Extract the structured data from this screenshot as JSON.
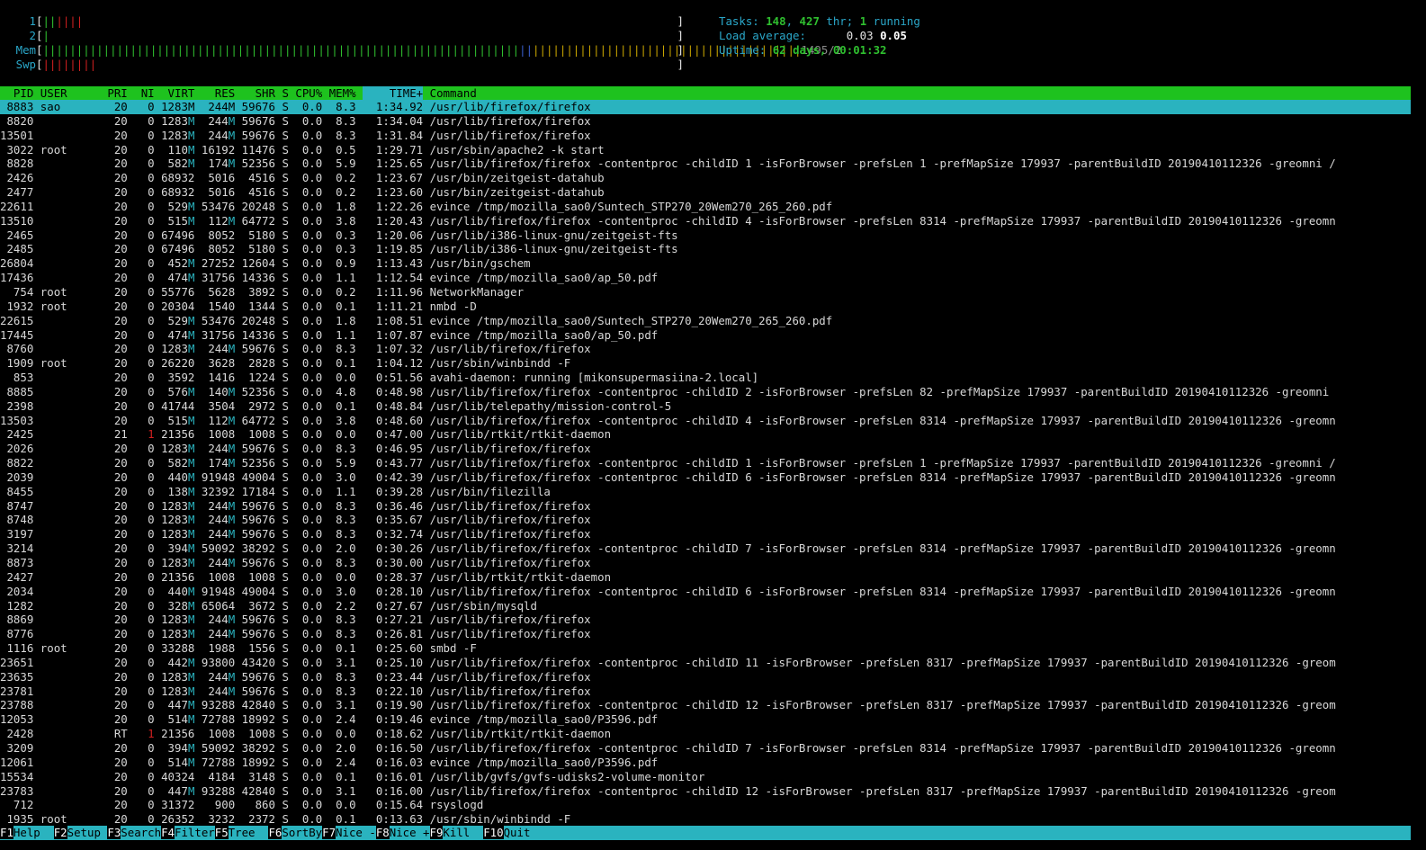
{
  "meters": [
    {
      "label": "1",
      "segments": [
        {
          "c": "g",
          "t": "||"
        },
        {
          "c": "r",
          "t": "||||"
        }
      ],
      "value": ""
    },
    {
      "label": "2",
      "segments": [
        {
          "c": "g",
          "t": "|"
        }
      ],
      "value": ""
    },
    {
      "label": "Mem",
      "segments": [
        {
          "c": "g",
          "t": "|||||||||||||||||||||||||||||||||||||||||||||||||||||||||||||||||||||||"
        },
        {
          "c": "b",
          "t": "||"
        },
        {
          "c": "y",
          "t": "||||||||||||||||||||||||||||||||||||||||"
        }
      ],
      "value": "1495/2"
    },
    {
      "label": "Swp",
      "segments": [
        {
          "c": "r",
          "t": "||||||||"
        }
      ],
      "value": ""
    }
  ],
  "stats": {
    "tasks_label": "Tasks: ",
    "tasks": "148",
    "thr_sep": ", ",
    "thr": "427",
    "thr_label": " thr; ",
    "running": "1",
    "running_label": " running",
    "load_label": "Load average: ",
    "load1": "0.03",
    "load2": "0.05",
    "uptime_label": "Uptime: ",
    "uptime": "62 days, 00:01:32"
  },
  "header": {
    "pid": "PID",
    "user": "USER",
    "pri": "PRI",
    "ni": "NI",
    "virt": "VIRT",
    "res": "RES",
    "shr": "SHR",
    "s": "S",
    "cpu": "CPU%",
    "mem": "MEM%",
    "time": "TIME+",
    "command": "Command"
  },
  "processes": [
    [
      "8883",
      "sao",
      "20",
      "0",
      "1283M",
      "244M",
      "59676",
      "S",
      "0.0",
      "8.3",
      "1:34.92",
      "/usr/lib/firefox/firefox"
    ],
    [
      "8820",
      "",
      "20",
      "0",
      "1283M",
      "244M",
      "59676",
      "S",
      "0.0",
      "8.3",
      "1:34.04",
      "/usr/lib/firefox/firefox"
    ],
    [
      "13501",
      "",
      "20",
      "0",
      "1283M",
      "244M",
      "59676",
      "S",
      "0.0",
      "8.3",
      "1:31.84",
      "/usr/lib/firefox/firefox"
    ],
    [
      "3022",
      "root",
      "20",
      "0",
      "110M",
      "16192",
      "11476",
      "S",
      "0.0",
      "0.5",
      "1:29.71",
      "/usr/sbin/apache2 -k start"
    ],
    [
      "8828",
      "",
      "20",
      "0",
      "582M",
      "174M",
      "52356",
      "S",
      "0.0",
      "5.9",
      "1:25.65",
      "/usr/lib/firefox/firefox -contentproc -childID 1 -isForBrowser -prefsLen 1 -prefMapSize 179937 -parentBuildID 20190410112326 -greomni /"
    ],
    [
      "2426",
      "",
      "20",
      "0",
      "68932",
      "5016",
      "4516",
      "S",
      "0.0",
      "0.2",
      "1:23.67",
      "/usr/bin/zeitgeist-datahub"
    ],
    [
      "2477",
      "",
      "20",
      "0",
      "68932",
      "5016",
      "4516",
      "S",
      "0.0",
      "0.2",
      "1:23.60",
      "/usr/bin/zeitgeist-datahub"
    ],
    [
      "22611",
      "",
      "20",
      "0",
      "529M",
      "53476",
      "20248",
      "S",
      "0.0",
      "1.8",
      "1:22.26",
      "evince /tmp/mozilla_sao0/Suntech_STP270_20Wem270_265_260.pdf"
    ],
    [
      "13510",
      "",
      "20",
      "0",
      "515M",
      "112M",
      "64772",
      "S",
      "0.0",
      "3.8",
      "1:20.43",
      "/usr/lib/firefox/firefox -contentproc -childID 4 -isForBrowser -prefsLen 8314 -prefMapSize 179937 -parentBuildID 20190410112326 -greomn"
    ],
    [
      "2465",
      "",
      "20",
      "0",
      "67496",
      "8052",
      "5180",
      "S",
      "0.0",
      "0.3",
      "1:20.06",
      "/usr/lib/i386-linux-gnu/zeitgeist-fts"
    ],
    [
      "2485",
      "",
      "20",
      "0",
      "67496",
      "8052",
      "5180",
      "S",
      "0.0",
      "0.3",
      "1:19.85",
      "/usr/lib/i386-linux-gnu/zeitgeist-fts"
    ],
    [
      "26804",
      "",
      "20",
      "0",
      "452M",
      "27252",
      "12604",
      "S",
      "0.0",
      "0.9",
      "1:13.43",
      "/usr/bin/gschem"
    ],
    [
      "17436",
      "",
      "20",
      "0",
      "474M",
      "31756",
      "14336",
      "S",
      "0.0",
      "1.1",
      "1:12.54",
      "evince /tmp/mozilla_sao0/ap_50.pdf"
    ],
    [
      "754",
      "root",
      "20",
      "0",
      "55776",
      "5628",
      "3892",
      "S",
      "0.0",
      "0.2",
      "1:11.96",
      "NetworkManager"
    ],
    [
      "1932",
      "root",
      "20",
      "0",
      "20304",
      "1540",
      "1344",
      "S",
      "0.0",
      "0.1",
      "1:11.21",
      "nmbd -D"
    ],
    [
      "22615",
      "",
      "20",
      "0",
      "529M",
      "53476",
      "20248",
      "S",
      "0.0",
      "1.8",
      "1:08.51",
      "evince /tmp/mozilla_sao0/Suntech_STP270_20Wem270_265_260.pdf"
    ],
    [
      "17445",
      "",
      "20",
      "0",
      "474M",
      "31756",
      "14336",
      "S",
      "0.0",
      "1.1",
      "1:07.87",
      "evince /tmp/mozilla_sao0/ap_50.pdf"
    ],
    [
      "8760",
      "",
      "20",
      "0",
      "1283M",
      "244M",
      "59676",
      "S",
      "0.0",
      "8.3",
      "1:07.32",
      "/usr/lib/firefox/firefox"
    ],
    [
      "1909",
      "root",
      "20",
      "0",
      "26220",
      "3628",
      "2828",
      "S",
      "0.0",
      "0.1",
      "1:04.12",
      "/usr/sbin/winbindd -F"
    ],
    [
      "853",
      "",
      "20",
      "0",
      "3592",
      "1416",
      "1224",
      "S",
      "0.0",
      "0.0",
      "0:51.56",
      "avahi-daemon: running [mikonsupermasiina-2.local]"
    ],
    [
      "8885",
      "",
      "20",
      "0",
      "576M",
      "140M",
      "52356",
      "S",
      "0.0",
      "4.8",
      "0:48.98",
      "/usr/lib/firefox/firefox -contentproc -childID 2 -isForBrowser -prefsLen 82 -prefMapSize 179937 -parentBuildID 20190410112326 -greomni"
    ],
    [
      "2398",
      "",
      "20",
      "0",
      "41744",
      "3504",
      "2972",
      "S",
      "0.0",
      "0.1",
      "0:48.84",
      "/usr/lib/telepathy/mission-control-5"
    ],
    [
      "13503",
      "",
      "20",
      "0",
      "515M",
      "112M",
      "64772",
      "S",
      "0.0",
      "3.8",
      "0:48.60",
      "/usr/lib/firefox/firefox -contentproc -childID 4 -isForBrowser -prefsLen 8314 -prefMapSize 179937 -parentBuildID 20190410112326 -greomn"
    ],
    [
      "2425",
      "",
      "21",
      "1",
      "21356",
      "1008",
      "1008",
      "S",
      "0.0",
      "0.0",
      "0:47.00",
      "/usr/lib/rtkit/rtkit-daemon"
    ],
    [
      "2026",
      "",
      "20",
      "0",
      "1283M",
      "244M",
      "59676",
      "S",
      "0.0",
      "8.3",
      "0:46.95",
      "/usr/lib/firefox/firefox"
    ],
    [
      "8822",
      "",
      "20",
      "0",
      "582M",
      "174M",
      "52356",
      "S",
      "0.0",
      "5.9",
      "0:43.77",
      "/usr/lib/firefox/firefox -contentproc -childID 1 -isForBrowser -prefsLen 1 -prefMapSize 179937 -parentBuildID 20190410112326 -greomni /"
    ],
    [
      "2039",
      "",
      "20",
      "0",
      "440M",
      "91948",
      "49004",
      "S",
      "0.0",
      "3.0",
      "0:42.39",
      "/usr/lib/firefox/firefox -contentproc -childID 6 -isForBrowser -prefsLen 8314 -prefMapSize 179937 -parentBuildID 20190410112326 -greomn"
    ],
    [
      "8455",
      "",
      "20",
      "0",
      "138M",
      "32392",
      "17184",
      "S",
      "0.0",
      "1.1",
      "0:39.28",
      "/usr/bin/filezilla"
    ],
    [
      "8747",
      "",
      "20",
      "0",
      "1283M",
      "244M",
      "59676",
      "S",
      "0.0",
      "8.3",
      "0:36.46",
      "/usr/lib/firefox/firefox"
    ],
    [
      "8748",
      "",
      "20",
      "0",
      "1283M",
      "244M",
      "59676",
      "S",
      "0.0",
      "8.3",
      "0:35.67",
      "/usr/lib/firefox/firefox"
    ],
    [
      "3197",
      "",
      "20",
      "0",
      "1283M",
      "244M",
      "59676",
      "S",
      "0.0",
      "8.3",
      "0:32.74",
      "/usr/lib/firefox/firefox"
    ],
    [
      "3214",
      "",
      "20",
      "0",
      "394M",
      "59092",
      "38292",
      "S",
      "0.0",
      "2.0",
      "0:30.26",
      "/usr/lib/firefox/firefox -contentproc -childID 7 -isForBrowser -prefsLen 8314 -prefMapSize 179937 -parentBuildID 20190410112326 -greomn"
    ],
    [
      "8873",
      "",
      "20",
      "0",
      "1283M",
      "244M",
      "59676",
      "S",
      "0.0",
      "8.3",
      "0:30.00",
      "/usr/lib/firefox/firefox"
    ],
    [
      "2427",
      "",
      "20",
      "0",
      "21356",
      "1008",
      "1008",
      "S",
      "0.0",
      "0.0",
      "0:28.37",
      "/usr/lib/rtkit/rtkit-daemon"
    ],
    [
      "2034",
      "",
      "20",
      "0",
      "440M",
      "91948",
      "49004",
      "S",
      "0.0",
      "3.0",
      "0:28.10",
      "/usr/lib/firefox/firefox -contentproc -childID 6 -isForBrowser -prefsLen 8314 -prefMapSize 179937 -parentBuildID 20190410112326 -greomn"
    ],
    [
      "1282",
      "",
      "20",
      "0",
      "328M",
      "65064",
      "3672",
      "S",
      "0.0",
      "2.2",
      "0:27.67",
      "/usr/sbin/mysqld"
    ],
    [
      "8869",
      "",
      "20",
      "0",
      "1283M",
      "244M",
      "59676",
      "S",
      "0.0",
      "8.3",
      "0:27.21",
      "/usr/lib/firefox/firefox"
    ],
    [
      "8776",
      "",
      "20",
      "0",
      "1283M",
      "244M",
      "59676",
      "S",
      "0.0",
      "8.3",
      "0:26.81",
      "/usr/lib/firefox/firefox"
    ],
    [
      "1116",
      "root",
      "20",
      "0",
      "33288",
      "1988",
      "1556",
      "S",
      "0.0",
      "0.1",
      "0:25.60",
      "smbd -F"
    ],
    [
      "23651",
      "",
      "20",
      "0",
      "442M",
      "93800",
      "43420",
      "S",
      "0.0",
      "3.1",
      "0:25.10",
      "/usr/lib/firefox/firefox -contentproc -childID 11 -isForBrowser -prefsLen 8317 -prefMapSize 179937 -parentBuildID 20190410112326 -greom"
    ],
    [
      "23635",
      "",
      "20",
      "0",
      "1283M",
      "244M",
      "59676",
      "S",
      "0.0",
      "8.3",
      "0:23.44",
      "/usr/lib/firefox/firefox"
    ],
    [
      "23781",
      "",
      "20",
      "0",
      "1283M",
      "244M",
      "59676",
      "S",
      "0.0",
      "8.3",
      "0:22.10",
      "/usr/lib/firefox/firefox"
    ],
    [
      "23788",
      "",
      "20",
      "0",
      "447M",
      "93288",
      "42840",
      "S",
      "0.0",
      "3.1",
      "0:19.90",
      "/usr/lib/firefox/firefox -contentproc -childID 12 -isForBrowser -prefsLen 8317 -prefMapSize 179937 -parentBuildID 20190410112326 -greom"
    ],
    [
      "12053",
      "",
      "20",
      "0",
      "514M",
      "72788",
      "18992",
      "S",
      "0.0",
      "2.4",
      "0:19.46",
      "evince /tmp/mozilla_sao0/P3596.pdf"
    ],
    [
      "2428",
      "",
      "RT",
      "1",
      "21356",
      "1008",
      "1008",
      "S",
      "0.0",
      "0.0",
      "0:18.62",
      "/usr/lib/rtkit/rtkit-daemon"
    ],
    [
      "3209",
      "",
      "20",
      "0",
      "394M",
      "59092",
      "38292",
      "S",
      "0.0",
      "2.0",
      "0:16.50",
      "/usr/lib/firefox/firefox -contentproc -childID 7 -isForBrowser -prefsLen 8314 -prefMapSize 179937 -parentBuildID 20190410112326 -greomn"
    ],
    [
      "12061",
      "",
      "20",
      "0",
      "514M",
      "72788",
      "18992",
      "S",
      "0.0",
      "2.4",
      "0:16.03",
      "evince /tmp/mozilla_sao0/P3596.pdf"
    ],
    [
      "15534",
      "",
      "20",
      "0",
      "40324",
      "4184",
      "3148",
      "S",
      "0.0",
      "0.1",
      "0:16.01",
      "/usr/lib/gvfs/gvfs-udisks2-volume-monitor"
    ],
    [
      "23783",
      "",
      "20",
      "0",
      "447M",
      "93288",
      "42840",
      "S",
      "0.0",
      "3.1",
      "0:16.00",
      "/usr/lib/firefox/firefox -contentproc -childID 12 -isForBrowser -prefsLen 8317 -prefMapSize 179937 -parentBuildID 20190410112326 -greom"
    ],
    [
      "712",
      "",
      "20",
      "0",
      "31372",
      "900",
      "860",
      "S",
      "0.0",
      "0.0",
      "0:15.64",
      "rsyslogd"
    ],
    [
      "1935",
      "root",
      "20",
      "0",
      "26352",
      "3232",
      "2372",
      "S",
      "0.0",
      "0.1",
      "0:13.63",
      "/usr/sbin/winbindd -F"
    ]
  ],
  "selected_index": 0,
  "footer": [
    {
      "key": "F1",
      "label": "Help  "
    },
    {
      "key": "F2",
      "label": "Setup "
    },
    {
      "key": "F3",
      "label": "Search"
    },
    {
      "key": "F4",
      "label": "Filter"
    },
    {
      "key": "F5",
      "label": "Tree  "
    },
    {
      "key": "F6",
      "label": "SortBy"
    },
    {
      "key": "F7",
      "label": "Nice -"
    },
    {
      "key": "F8",
      "label": "Nice +"
    },
    {
      "key": "F9",
      "label": "Kill  "
    },
    {
      "key": "F10",
      "label": "Quit"
    }
  ]
}
